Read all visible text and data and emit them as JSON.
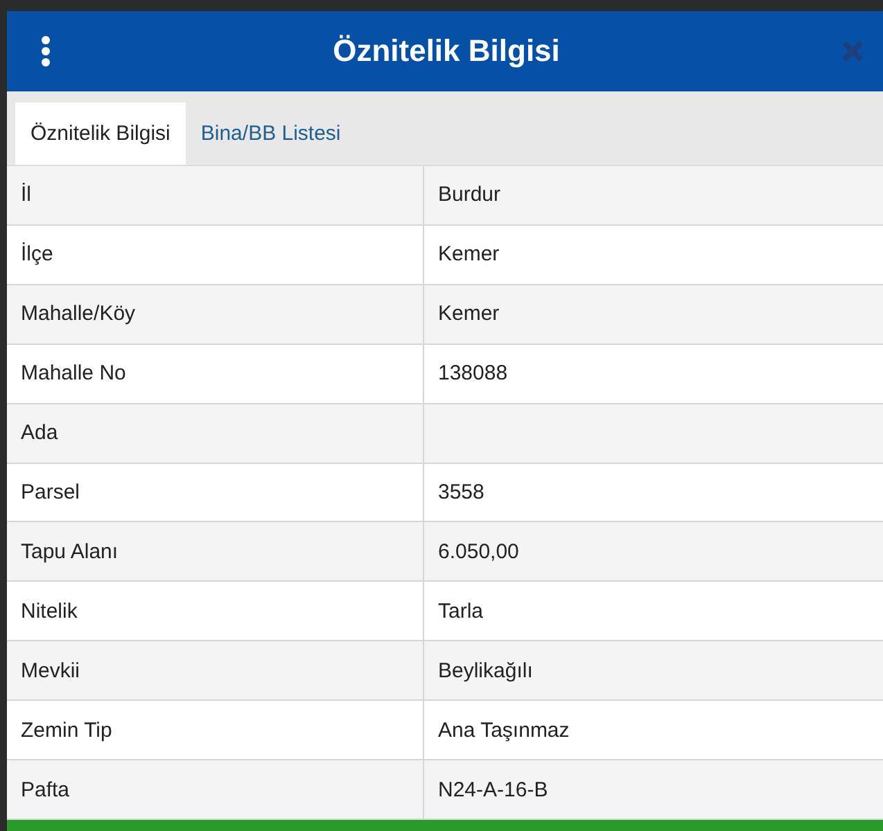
{
  "dialog": {
    "title": "Öznitelik Bilgisi"
  },
  "tabs": [
    {
      "label": "Öznitelik Bilgisi",
      "selected": true
    },
    {
      "label": "Bina/BB Listesi",
      "selected": false
    }
  ],
  "rows": [
    {
      "label": "İl",
      "value": "Burdur"
    },
    {
      "label": "İlçe",
      "value": "Kemer"
    },
    {
      "label": "Mahalle/Köy",
      "value": "Kemer"
    },
    {
      "label": "Mahalle No",
      "value": "138088"
    },
    {
      "label": "Ada",
      "value": ""
    },
    {
      "label": "Parsel",
      "value": "3558"
    },
    {
      "label": "Tapu Alanı",
      "value": "6.050,00"
    },
    {
      "label": "Nitelik",
      "value": "Tarla"
    },
    {
      "label": "Mevkii",
      "value": "Beylikağılı"
    },
    {
      "label": "Zemin Tip",
      "value": "Ana Taşınmaz"
    },
    {
      "label": "Pafta",
      "value": "N24-A-16-B"
    }
  ]
}
